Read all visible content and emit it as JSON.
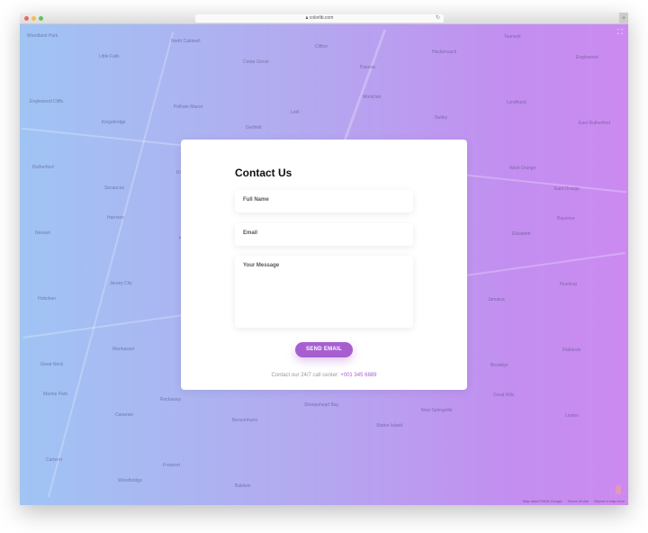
{
  "browser": {
    "url": "colorlib.com",
    "traffic_colors": [
      "#ec6a5e",
      "#f4bf4f",
      "#61c554"
    ]
  },
  "map": {
    "labels": [
      "Woodland Park",
      "Little Falls",
      "North Caldwell",
      "Cedar Grove",
      "Clifton",
      "Passaic",
      "Hackensack",
      "Teaneck",
      "Englewood",
      "Englewood Cliffs",
      "Kingsbridge",
      "Pelham Manor",
      "Garfield",
      "Lodi",
      "Montclair",
      "Nutley",
      "Lyndhurst",
      "East Rutherford",
      "Rutherford",
      "Secaucus",
      "Ridgefield",
      "Fort Lee",
      "Edgewater",
      "Cliffside Park",
      "Glen Ridge",
      "West Orange",
      "East Orange",
      "Newark",
      "Harrison",
      "Kearny",
      "Bloomfield",
      "Irvington",
      "Hillside",
      "Union",
      "Elizabeth",
      "Bayonne",
      "Hoboken",
      "Jersey City",
      "Upper Manhattan",
      "Bronx",
      "New Rochelle",
      "Mamaroneck",
      "Queens",
      "Jamaica",
      "Flushing",
      "Great Neck",
      "Manhasset",
      "Elmont",
      "Valley Stream",
      "Hempstead",
      "Oceanside",
      "Lawrence",
      "Brooklyn",
      "Flatlands",
      "Marine Park",
      "Canarsie",
      "Rockaway",
      "Bensonhurst",
      "Sheepshead Bay",
      "Staten Island",
      "New Springville",
      "Great Kills",
      "Linden",
      "Carteret",
      "Woodbridge",
      "Freeport",
      "Baldwin"
    ],
    "attribution": "Map data ©2018 Google",
    "terms": "Terms of Use",
    "report": "Report a map error"
  },
  "form": {
    "title": "Contact Us",
    "name_placeholder": "Full Name",
    "email_placeholder": "Email",
    "message_placeholder": "Your Message",
    "submit_label": "SEND EMAIL",
    "footer_text": "Contact our 24/7 call center:",
    "phone": "+001 345 6889"
  }
}
